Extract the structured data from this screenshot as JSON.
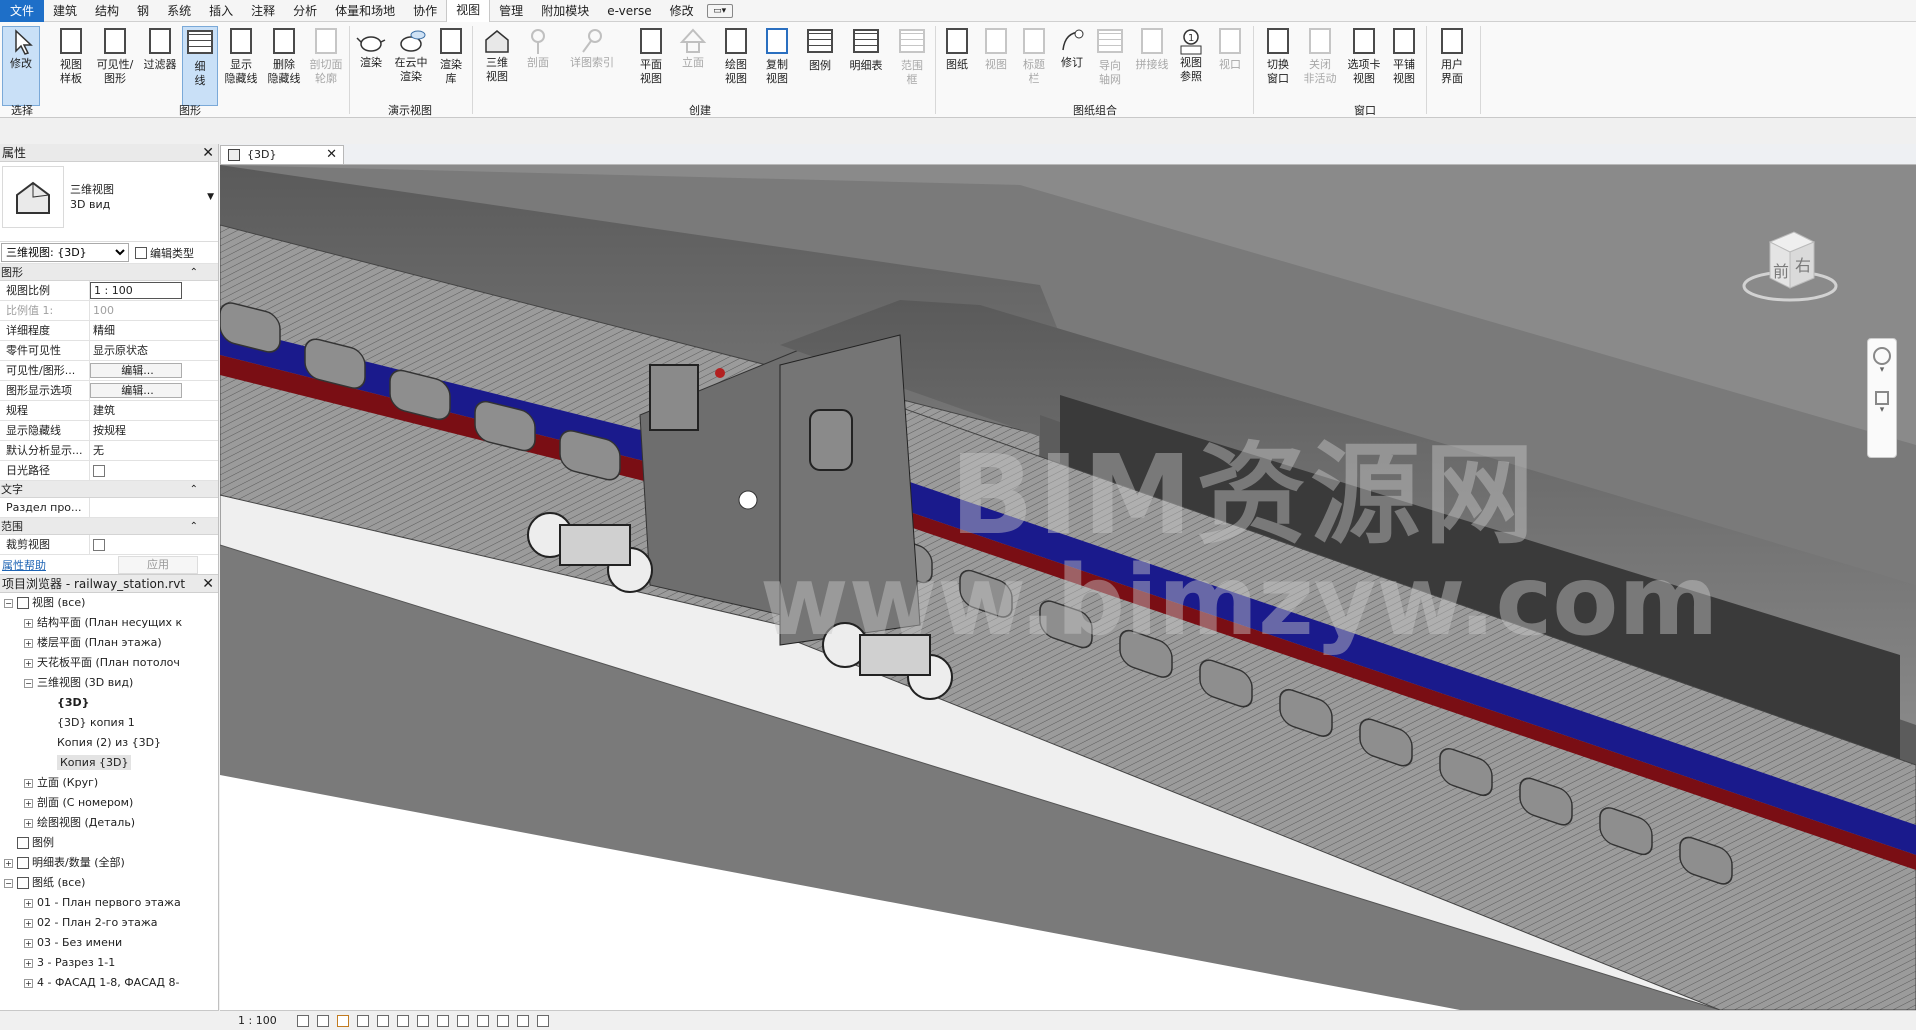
{
  "menubar": {
    "items": [
      "文件",
      "建筑",
      "结构",
      "钢",
      "系统",
      "插入",
      "注释",
      "分析",
      "体量和场地",
      "协作",
      "视图",
      "管理",
      "附加模块",
      "e-verse",
      "修改"
    ],
    "active": "视图"
  },
  "ribbon": {
    "buttons": [
      {
        "id": "modify",
        "l1": "修改",
        "l2": ""
      },
      {
        "id": "view-template",
        "l1": "视图",
        "l2": "样板"
      },
      {
        "id": "vis-graphics",
        "l1": "可见性/",
        "l2": "图形"
      },
      {
        "id": "filters",
        "l1": "过滤器",
        "l2": ""
      },
      {
        "id": "thin-lines",
        "l1": "细",
        "l2": "线"
      },
      {
        "id": "show-hidden",
        "l1": "显示",
        "l2": "隐藏线"
      },
      {
        "id": "remove-hidden",
        "l1": "删除",
        "l2": "隐藏线"
      },
      {
        "id": "cut-profile",
        "l1": "剖切面",
        "l2": "轮廓"
      },
      {
        "id": "render",
        "l1": "渲染",
        "l2": ""
      },
      {
        "id": "render-cloud",
        "l1": "在云中",
        "l2": "渲染"
      },
      {
        "id": "render-gallery",
        "l1": "渲染",
        "l2": "库"
      },
      {
        "id": "3d-view",
        "l1": "三维",
        "l2": "视图"
      },
      {
        "id": "section",
        "l1": "剖面",
        "l2": ""
      },
      {
        "id": "callout",
        "l1": "详图索引",
        "l2": ""
      },
      {
        "id": "plan-views",
        "l1": "平面",
        "l2": "视图"
      },
      {
        "id": "elevation",
        "l1": "立面",
        "l2": ""
      },
      {
        "id": "drafting-view",
        "l1": "绘图",
        "l2": "视图"
      },
      {
        "id": "duplicate-view",
        "l1": "复制",
        "l2": "视图"
      },
      {
        "id": "legends",
        "l1": "图例",
        "l2": ""
      },
      {
        "id": "schedules",
        "l1": "明细表",
        "l2": ""
      },
      {
        "id": "scope-box",
        "l1": "范围",
        "l2": "框"
      },
      {
        "id": "sheet",
        "l1": "图纸",
        "l2": ""
      },
      {
        "id": "view",
        "l1": "视图",
        "l2": ""
      },
      {
        "id": "title-block",
        "l1": "标题",
        "l2": "栏"
      },
      {
        "id": "revisions",
        "l1": "修订",
        "l2": ""
      },
      {
        "id": "guide-grid",
        "l1": "导向",
        "l2": "轴网"
      },
      {
        "id": "matchline",
        "l1": "拼接线",
        "l2": ""
      },
      {
        "id": "view-reference",
        "l1": "视图",
        "l2": "参照"
      },
      {
        "id": "viewports",
        "l1": "视口",
        "l2": ""
      },
      {
        "id": "switch-windows",
        "l1": "切换",
        "l2": "窗口"
      },
      {
        "id": "close-inactive",
        "l1": "关闭",
        "l2": "非活动"
      },
      {
        "id": "tab-views",
        "l1": "选项卡",
        "l2": "视图"
      },
      {
        "id": "tile-views",
        "l1": "平铺",
        "l2": "视图"
      },
      {
        "id": "user-interface",
        "l1": "用户",
        "l2": "界面"
      }
    ],
    "panels": [
      "选择",
      "图形",
      "演示视图",
      "创建",
      "图纸组合",
      "窗口"
    ]
  },
  "properties": {
    "title": "属性",
    "type_line1": "三维视图",
    "type_line2": "3D вид",
    "instance_selector": "三维视图: {3D}",
    "edit_type": "编辑类型",
    "groups": {
      "graphics": "图形",
      "text": "文字",
      "extents": "范围"
    },
    "rows": [
      {
        "k": "视图比例",
        "v": "1 : 100"
      },
      {
        "k": "比例值 1:",
        "v": "100"
      },
      {
        "k": "详细程度",
        "v": "精细"
      },
      {
        "k": "零件可见性",
        "v": "显示原状态"
      },
      {
        "k": "可见性/图形...",
        "v": "编辑..."
      },
      {
        "k": "图形显示选项",
        "v": "编辑..."
      },
      {
        "k": "规程",
        "v": "建筑"
      },
      {
        "k": "显示隐藏线",
        "v": "按规程"
      },
      {
        "k": "默认分析显示...",
        "v": "无"
      },
      {
        "k": "日光路径",
        "v": ""
      },
      {
        "k": "Раздел про...",
        "v": ""
      },
      {
        "k": "裁剪视图",
        "v": ""
      }
    ],
    "help_link": "属性帮助",
    "apply": "应用"
  },
  "browser": {
    "title": "项目浏览器 - railway_station.rvt",
    "nodes": [
      {
        "t": "视图 (все)",
        "lvl": 0,
        "exp": "−"
      },
      {
        "t": "结构平面 (План несущих к",
        "lvl": 1,
        "exp": "+"
      },
      {
        "t": "楼层平面 (План этажа)",
        "lvl": 1,
        "exp": "+"
      },
      {
        "t": "天花板平面 (План потолоч",
        "lvl": 1,
        "exp": "+"
      },
      {
        "t": "三维视图 (3D вид)",
        "lvl": 1,
        "exp": "−"
      },
      {
        "t": "{3D}",
        "lvl": 2,
        "exp": ""
      },
      {
        "t": "{3D} копия 1",
        "lvl": 2,
        "exp": ""
      },
      {
        "t": "Копия (2) из {3D}",
        "lvl": 2,
        "exp": ""
      },
      {
        "t": "Копия {3D}",
        "lvl": 2,
        "exp": ""
      },
      {
        "t": "立面 (Круг)",
        "lvl": 1,
        "exp": "+"
      },
      {
        "t": "剖面 (С номером)",
        "lvl": 1,
        "exp": "+"
      },
      {
        "t": "绘图视图 (Деталь)",
        "lvl": 1,
        "exp": "+"
      },
      {
        "t": "图例",
        "lvl": 0,
        "exp": ""
      },
      {
        "t": "明细表/数量 (全部)",
        "lvl": 0,
        "exp": "+"
      },
      {
        "t": "图纸 (все)",
        "lvl": 0,
        "exp": "−"
      },
      {
        "t": "01 - План первого этажа",
        "lvl": 1,
        "exp": "+"
      },
      {
        "t": "02 - План 2-го этажа",
        "lvl": 1,
        "exp": "+"
      },
      {
        "t": "03 - Без имени",
        "lvl": 1,
        "exp": "+"
      },
      {
        "t": "3 - Разрез 1-1",
        "lvl": 1,
        "exp": "+"
      },
      {
        "t": "4 - ФАСАД 1-8, ФАСАД 8-",
        "lvl": 1,
        "exp": "+"
      }
    ]
  },
  "view_tab": {
    "label": "{3D}"
  },
  "viewcube": {
    "front": "前",
    "right": "右"
  },
  "watermark": {
    "line1": "BIM资源网",
    "line2": "www.bimzyw.com"
  },
  "status": {
    "scale": "1 : 100"
  },
  "colors": {
    "accent": "#1e6fc8",
    "body": "#8a8a8a",
    "stripe_blue": "#1a1a8c",
    "stripe_red": "#7a0e14"
  }
}
